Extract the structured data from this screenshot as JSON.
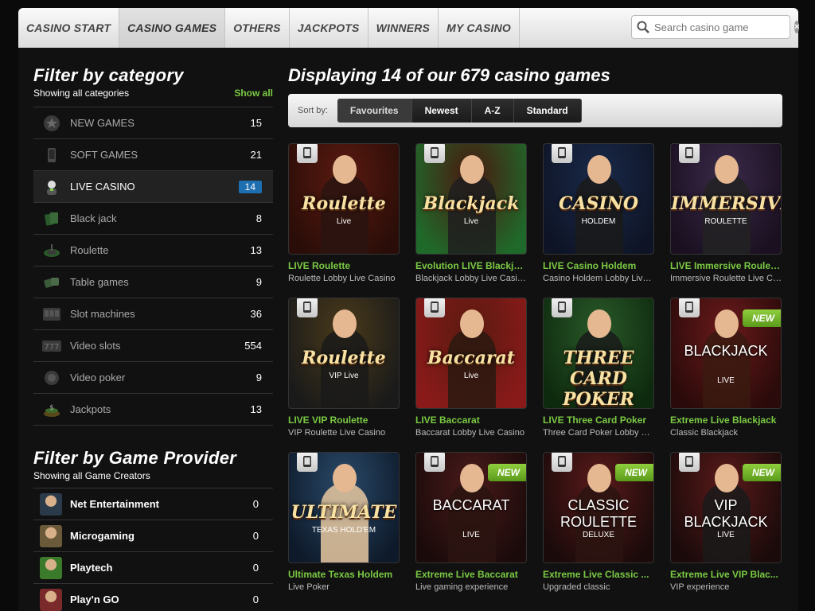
{
  "nav": {
    "tabs": [
      "CASINO START",
      "CASINO GAMES",
      "OTHERS",
      "JACKPOTS",
      "WINNERS",
      "MY CASINO"
    ],
    "active_tab": "CASINO GAMES",
    "search_placeholder": "Search casino game"
  },
  "sidebar": {
    "category": {
      "title": "Filter by category",
      "subtitle": "Showing all categories",
      "show_all": "Show all",
      "items": [
        {
          "label": "NEW GAMES",
          "count": "15",
          "icon": "star-icon"
        },
        {
          "label": "SOFT GAMES",
          "count": "21",
          "icon": "phone-icon"
        },
        {
          "label": "LIVE CASINO",
          "count": "14",
          "icon": "dealer-icon",
          "active": true
        },
        {
          "label": "Black jack",
          "count": "8",
          "icon": "cards-icon"
        },
        {
          "label": "Roulette",
          "count": "13",
          "icon": "roulette-icon"
        },
        {
          "label": "Table games",
          "count": "9",
          "icon": "dice-icon"
        },
        {
          "label": "Slot machines",
          "count": "36",
          "icon": "slot-machine-icon"
        },
        {
          "label": "Video slots",
          "count": "554",
          "icon": "video-slots-icon"
        },
        {
          "label": "Video poker",
          "count": "9",
          "icon": "poker-chip-icon"
        },
        {
          "label": "Jackpots",
          "count": "13",
          "icon": "jackpot-icon"
        }
      ]
    },
    "provider": {
      "title": "Filter by Game Provider",
      "subtitle": "Showing all Game Creators",
      "items": [
        {
          "label": "Net Entertainment",
          "count": "0",
          "color": "#2b3a4a"
        },
        {
          "label": "Microgaming",
          "count": "0",
          "color": "#6a5a3a"
        },
        {
          "label": "Playtech",
          "count": "0",
          "color": "#3a7a2a"
        },
        {
          "label": "Play'n GO",
          "count": "0",
          "color": "#7a2a2a"
        }
      ]
    }
  },
  "main": {
    "title": "Displaying 14 of our 679 casino games",
    "sort_label": "Sort by:",
    "sort_options": [
      "Favourites",
      "Newest",
      "A-Z",
      "Standard"
    ],
    "sort_active": "Favourites",
    "new_badge": "NEW",
    "games": [
      {
        "title": "LIVE Roulette",
        "sub": "Roulette Lobby Live Casino",
        "logo": "Roulette",
        "logo_sub": "Live",
        "bg": "#5a1a10",
        "bg2": "#2a0d08",
        "person": "#2a1410",
        "isnew": false,
        "plain": false
      },
      {
        "title": "Evolution LIVE Blackjack",
        "sub": "Blackjack Lobby Live Casino",
        "logo": "Blackjack",
        "logo_sub": "Live",
        "bg": "#4a1810",
        "bg2": "#1f6a2a",
        "person": "#1e1e1e",
        "isnew": false,
        "plain": false
      },
      {
        "title": "LIVE Casino Holdem",
        "sub": "Casino Holdem Lobby Live...",
        "logo": "CASINO",
        "logo_sub": "HOLDEM",
        "bg": "#1a2a4a",
        "bg2": "#0e1426",
        "person": "#1a1a1a",
        "isnew": false,
        "plain": false
      },
      {
        "title": "LIVE Immersive Roulette",
        "sub": "Immersive Roulette Live Ca...",
        "logo": "IMMERSIVE",
        "logo_sub": "ROULETTE",
        "bg": "#3a2a4a",
        "bg2": "#1a1020",
        "person": "#222222",
        "isnew": false,
        "plain": false
      },
      {
        "title": "LIVE VIP Roulette",
        "sub": "VIP Roulette Live Casino",
        "logo": "Roulette",
        "logo_sub": "VIP  Live",
        "bg": "#4a3a1a",
        "bg2": "#1a1a1a",
        "person": "#1a1a1a",
        "isnew": false,
        "plain": false
      },
      {
        "title": "LIVE Baccarat",
        "sub": "Baccarat Lobby Live Casino",
        "logo": "Baccarat",
        "logo_sub": "Live",
        "bg": "#5a1a10",
        "bg2": "#8a1a1a",
        "person": "#2a1a10",
        "isnew": false,
        "plain": false
      },
      {
        "title": "LIVE Three Card Poker",
        "sub": "Three Card Poker Lobby Li...",
        "logo": "THREE CARD POKER",
        "logo_sub": "",
        "bg": "#2a5a2a",
        "bg2": "#0e2a0e",
        "person": "#1a1a1a",
        "isnew": false,
        "plain": false
      },
      {
        "title": "Extreme Live Blackjack",
        "sub": "Classic Blackjack",
        "logo": "BLACKJACK",
        "logo_sub": "LIVE",
        "bg": "#6a1a1a",
        "bg2": "#2a0a0a",
        "person": "#3a1a10",
        "isnew": true,
        "plain": true
      },
      {
        "title": "Ultimate Texas Holdem",
        "sub": "Live Poker",
        "logo": "ULTIMATE",
        "logo_sub": "TEXAS HOLD'EM",
        "bg": "#2a4a6a",
        "bg2": "#0e1a2a",
        "person": "#e8c8a0",
        "isnew": false,
        "plain": false
      },
      {
        "title": "Extreme Live Baccarat",
        "sub": "Live gaming experience",
        "logo": "BACCARAT",
        "logo_sub": "LIVE",
        "bg": "#4a1a1a",
        "bg2": "#1a0a0a",
        "person": "#2a1410",
        "isnew": true,
        "plain": true
      },
      {
        "title": "Extreme Live Classic ...",
        "sub": "Upgraded classic",
        "logo": "CLASSIC ROULETTE",
        "logo_sub": "DELUXE",
        "bg": "#5a1a1a",
        "bg2": "#1a0a0a",
        "person": "#2a1410",
        "isnew": true,
        "plain": true
      },
      {
        "title": "Extreme Live VIP Blac...",
        "sub": "VIP experience",
        "logo": "VIP BLACKJACK",
        "logo_sub": "LIVE",
        "bg": "#5a1a1a",
        "bg2": "#1a0a0a",
        "person": "#1a1a1a",
        "isnew": true,
        "plain": true
      }
    ]
  }
}
